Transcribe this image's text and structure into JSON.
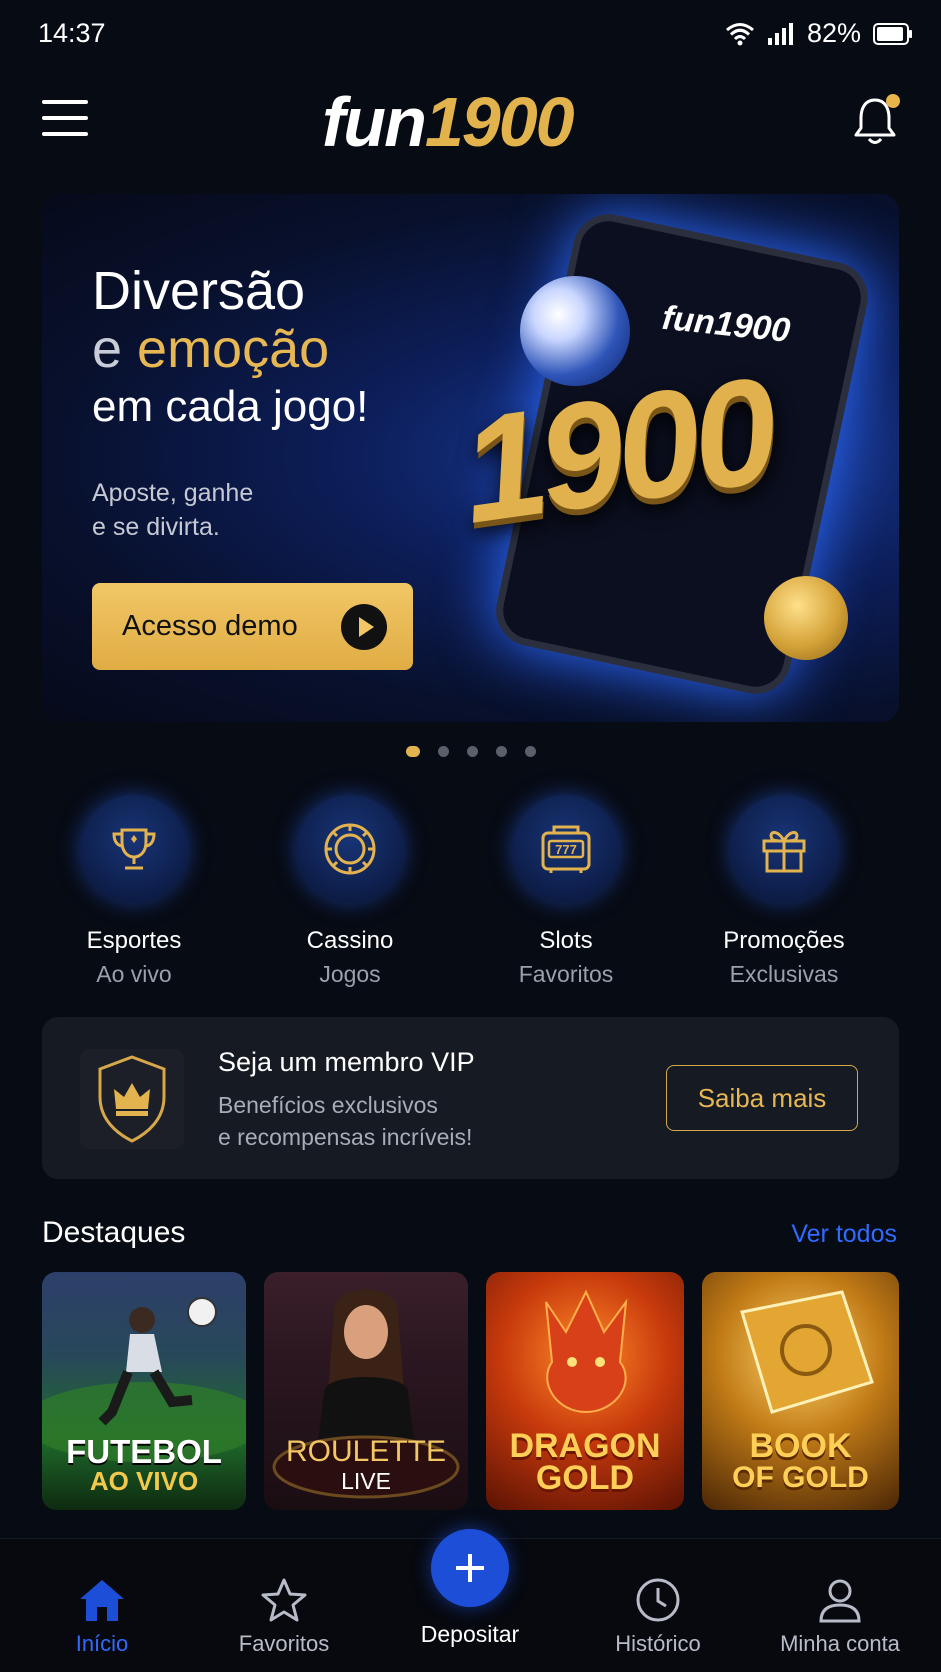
{
  "status": {
    "time": "14:37",
    "battery": "82%"
  },
  "header": {
    "logo_white": "fun",
    "logo_gold": "1900",
    "menu_icon": "hamburger-menu-icon",
    "notification_icon": "bell-icon"
  },
  "banner": {
    "title_line1": "Diversão",
    "title_line2_white": "e ",
    "title_line2_gold": "emoção",
    "title_line3": "em cada jogo!",
    "subtitle_line1": "Aposte, ganhe",
    "subtitle_line2": "e se divirta.",
    "cta_label": "Acesso demo",
    "phone_logo": "fun1900",
    "big_number": "1900"
  },
  "carousel": {
    "count": 5,
    "active_index": 0
  },
  "categories": [
    {
      "title": "Esportes",
      "sub": "Ao vivo",
      "icon": "trophy-icon"
    },
    {
      "title": "Cassino",
      "sub": "Jogos",
      "icon": "casino-chip-icon"
    },
    {
      "title": "Slots",
      "sub": "Favoritos",
      "icon": "slot-machine-icon"
    },
    {
      "title": "Promoções",
      "sub": "Exclusivas",
      "icon": "gift-icon"
    }
  ],
  "vip": {
    "title": "Seja um membro VIP",
    "desc_line1": "Benefícios exclusivos",
    "desc_line2": "e recompensas incríveis!",
    "button": "Saiba mais",
    "icon": "crown-shield-icon"
  },
  "highlights": {
    "title": "Destaques",
    "see_all": "Ver todos",
    "tiles": [
      {
        "line1": "FUTEBOL",
        "line2": "AO VIVO"
      },
      {
        "line1": "ROULETTE",
        "line2": "LIVE"
      },
      {
        "line1": "DRAGON",
        "line2": "GOLD"
      },
      {
        "line1": "BOOK",
        "line2": "OF GOLD"
      }
    ]
  },
  "bottom_nav": {
    "items": [
      {
        "label": "Início",
        "icon": "home-icon",
        "active": true
      },
      {
        "label": "Favoritos",
        "icon": "star-icon",
        "active": false
      },
      {
        "label": "Depositar",
        "icon": "plus-icon",
        "active": false
      },
      {
        "label": "Histórico",
        "icon": "clock-icon",
        "active": false
      },
      {
        "label": "Minha conta",
        "icon": "user-icon",
        "active": false
      }
    ]
  },
  "colors": {
    "background": "#070b14",
    "gold": "#e3b34f",
    "accent_blue": "#2f6bff",
    "card": "#161a22"
  }
}
